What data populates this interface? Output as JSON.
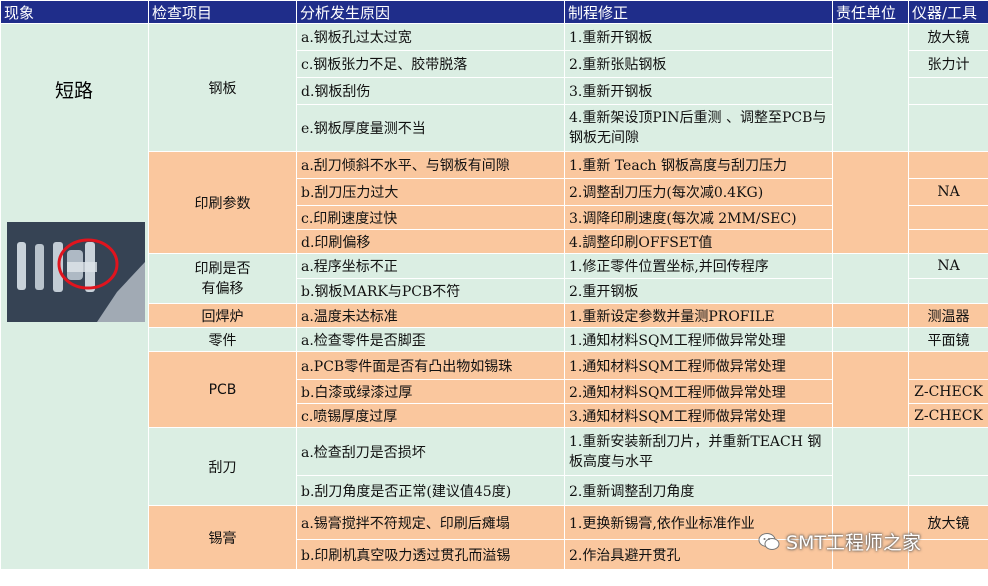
{
  "headers": [
    "现象",
    "检查项目",
    "分析发生原因",
    "制程修正",
    "责任单位",
    "仪器/工具"
  ],
  "phenomenon": "短路",
  "groups": [
    {
      "item": "钢板",
      "rows": [
        {
          "cause": "a.钢板孔过太过宽",
          "fix": "1.重新开钢板",
          "tool": "放大镜"
        },
        {
          "cause": "c.钢板张力不足、胶带脱落",
          "fix": "2.重新张贴钢板",
          "tool": "张力计"
        },
        {
          "cause": "d.钢板刮伤",
          "fix": "3.重新开钢板",
          "tool": ""
        },
        {
          "cause": "e.钢板厚度量测不当",
          "fix": "4.重新架设顶PIN后重测 、调整至PCB与钢板无间隙",
          "tool": ""
        }
      ]
    },
    {
      "item": "印刷参数",
      "rows": [
        {
          "cause": "a.刮刀倾斜不水平、与钢板有间隙",
          "fix": "1.重新 Teach 钢板高度与刮刀压力",
          "tool": ""
        },
        {
          "cause": "b.刮刀压力过大",
          "fix": "2.调整刮刀压力(每次减0.4KG)",
          "tool": "NA"
        },
        {
          "cause": "c.印刷速度过快",
          "fix": "3.调降印刷速度(每次减 2MM/SEC)",
          "tool": ""
        },
        {
          "cause": "d.印刷偏移",
          "fix": "4.調整印刷OFFSET值",
          "tool": ""
        }
      ]
    },
    {
      "item": "印刷是否有偏移",
      "rows": [
        {
          "cause": "a.程序坐标不正",
          "fix": "1.修正零件位置坐标,并回传程序",
          "tool": "NA"
        },
        {
          "cause": "b.钢板MARK与PCB不符",
          "fix": "2.重开钢板",
          "tool": ""
        }
      ]
    },
    {
      "item": "回焊炉",
      "rows": [
        {
          "cause": "a.温度未达标准",
          "fix": "1.重新设定参数并量测PROFILE",
          "tool": "测温器"
        }
      ]
    },
    {
      "item": "零件",
      "rows": [
        {
          "cause": "a.检查零件是否脚歪",
          "fix": "1.通知材料SQM工程师做异常处理",
          "tool": "平面镜"
        }
      ]
    },
    {
      "item": "PCB",
      "rows": [
        {
          "cause": "a.PCB零件面是否有凸出物如锡珠",
          "fix": "1.通知材料SQM工程师做异常处理",
          "tool": ""
        },
        {
          "cause": "b.白漆或绿漆过厚",
          "fix": "2.通知材料SQM工程师做异常处理",
          "tool": "Z-CHECK"
        },
        {
          "cause": "c.喷锡厚度过厚",
          "fix": "3.通知材料SQM工程师做异常处理",
          "tool": "Z-CHECK"
        }
      ]
    },
    {
      "item": "刮刀",
      "rows": [
        {
          "cause": "a.检查刮刀是否损坏",
          "fix": "1.重新安装新刮刀片，并重新TEACH 钢板高度与水平",
          "tool": ""
        },
        {
          "cause": "b.刮刀角度是否正常(建议值45度)",
          "fix": "2.重新调整刮刀角度",
          "tool": ""
        }
      ]
    },
    {
      "item": "锡膏",
      "rows": [
        {
          "cause": "a.锡膏搅拌不符规定、印刷后瘫塌",
          "fix": "1.更换新锡膏,依作业标准作业",
          "tool": "放大镜"
        },
        {
          "cause": "b.印刷机真空吸力透过贯孔而溢锡",
          "fix": "2.作治具避开贯孔",
          "tool": ""
        }
      ]
    }
  ],
  "watermark": "SMT工程师之家",
  "colors": {
    "header": "#1f2d8a",
    "green": "#dbeee3",
    "orange": "#fac79e"
  }
}
